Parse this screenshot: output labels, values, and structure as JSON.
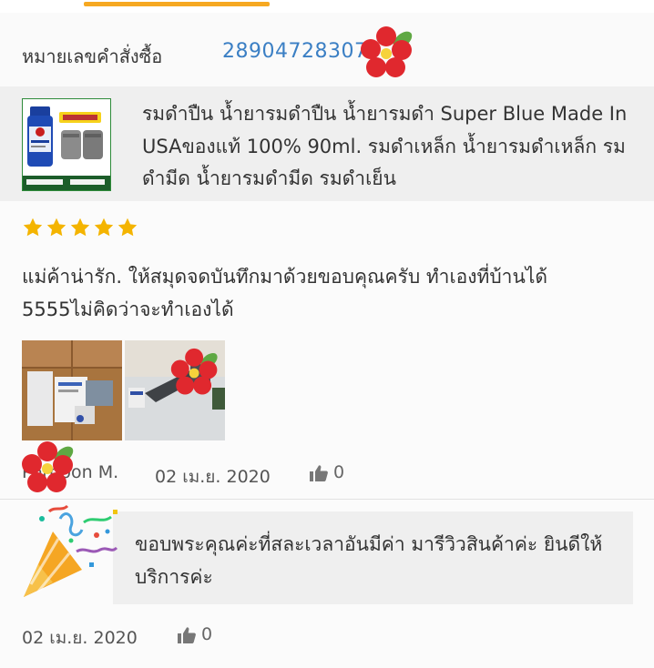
{
  "order": {
    "label": "หมายเลขคำสั่งซื้อ",
    "number": "28904728307"
  },
  "product": {
    "title": "รมดำปืน น้ำยารมดำปืน น้ำยารมดำ Super Blue Made In USAของแท้ 100% 90ml. รมดำเหล็ก น้ำยารมดำเหล็ก รมดำมีด น้ำยารมดำมีด รมดำเย็น",
    "thumb_badge": "ของแท้",
    "thumb_brand": "Super Blue"
  },
  "review": {
    "rating": 5,
    "text": "แม่ค้าน่ารัก. ให้สมุดจดบันทึกมาด้วยขอบคุณครับ  ทำเองที่บ้านได้  5555ไม่คิดว่าจะทำเองได้",
    "reviewer": "Pornpon M.",
    "date": "02 เม.ย. 2020",
    "likes": "0"
  },
  "seller_reply": {
    "text": "ขอบพระคุณค่ะที่สละเวลาอันมีค่า มารีวิวสินค้าค่ะ  ยินดีให้บริการค่ะ",
    "date": "02 เม.ย. 2020",
    "likes": "0"
  },
  "colors": {
    "accent": "#f6a821",
    "link": "#3b7fc4",
    "star": "#f4b400"
  },
  "icons": [
    "star-icon",
    "thumbs-up-icon",
    "party-popper-icon",
    "flower-sticker-icon"
  ]
}
